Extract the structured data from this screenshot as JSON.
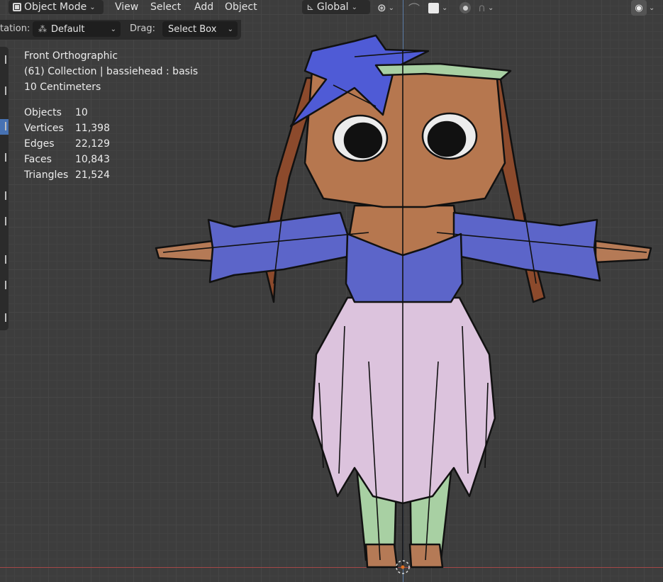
{
  "header": {
    "mode": "Object Mode",
    "menus": [
      "View",
      "Select",
      "Add",
      "Object"
    ],
    "transform_orientation": "Global"
  },
  "tool_settings": {
    "orientation_label": "tation:",
    "orientation_value": "Default",
    "drag_label": "Drag:",
    "drag_value": "Select Box"
  },
  "overlay_info": {
    "view": "Front Orthographic",
    "collection": "(61) Collection | bassiehead : basis",
    "scale": "10 Centimeters"
  },
  "stats": [
    {
      "label": "Objects",
      "value": "10"
    },
    {
      "label": "Vertices",
      "value": "11,398"
    },
    {
      "label": "Edges",
      "value": "22,129"
    },
    {
      "label": "Faces",
      "value": "10,843"
    },
    {
      "label": "Triangles",
      "value": "21,524"
    }
  ],
  "icons": {
    "mode": "object-mode-icon",
    "orientation": "transform-orientation-icon",
    "pivot": "pivot-point-icon",
    "snap": "snap-icon",
    "proportional": "proportional-editing-icon",
    "visibility": "eye-icon"
  },
  "colors": {
    "viewport_bg": "#3d3d3d",
    "axis_red": "#a44747",
    "axis_blue": "#5d7da8",
    "active_tool": "#4772b3"
  }
}
